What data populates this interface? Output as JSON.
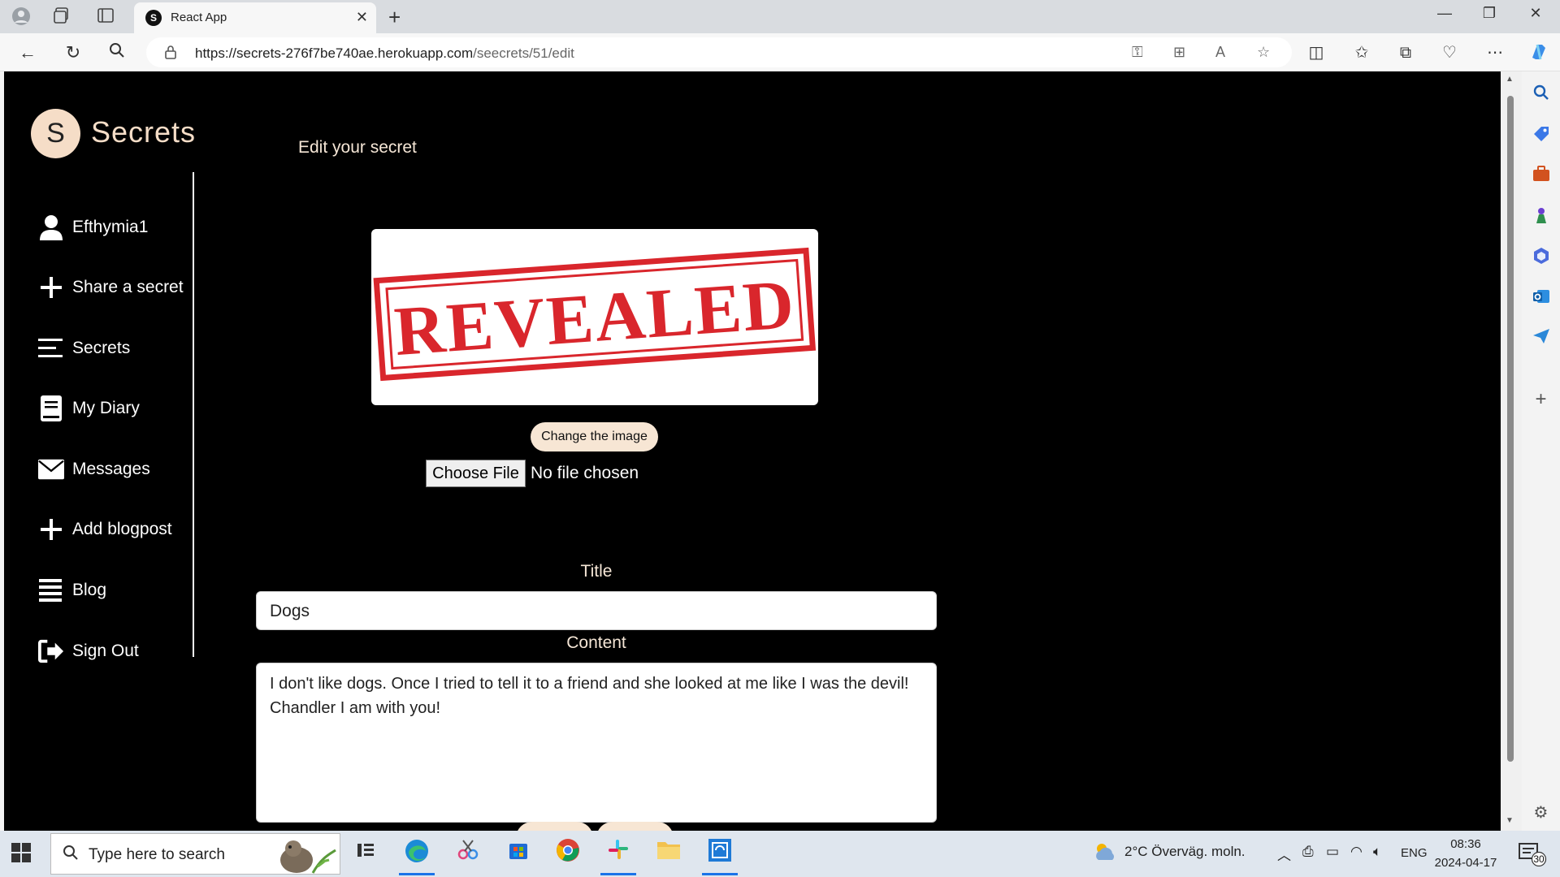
{
  "browser": {
    "tab_title": "React App",
    "tab_favicon_letter": "S",
    "url_host": "https://secrets-276f7be740ae.herokuapp.com",
    "url_path": "/seecrets/51/edit"
  },
  "sidebar": {
    "logo_letter": "S",
    "logo_text": "Secrets",
    "items": [
      {
        "label": "Efthymia1",
        "icon": "user-icon"
      },
      {
        "label": "Share a secret",
        "icon": "plus-icon"
      },
      {
        "label": "Secrets",
        "icon": "list-icon"
      },
      {
        "label": "My Diary",
        "icon": "book-icon"
      },
      {
        "label": "Messages",
        "icon": "envelope-icon"
      },
      {
        "label": "Add blogpost",
        "icon": "plus-icon"
      },
      {
        "label": "Blog",
        "icon": "list-icon"
      },
      {
        "label": "Sign Out",
        "icon": "sign-out-icon"
      }
    ]
  },
  "form": {
    "heading": "Edit your secret",
    "image_text": "REVEALED",
    "change_image_label": "Change the image",
    "file_button_label": "Choose File",
    "file_status": "No file chosen",
    "title_label": "Title",
    "title_value": "Dogs",
    "content_label": "Content",
    "content_value": "I don't like dogs. Once I tried to tell it to a friend and she looked at me like I was the devil! Chandler I am with you!"
  },
  "taskbar": {
    "search_placeholder": "Type here to search",
    "weather": "2°C  Överväg. moln.",
    "language": "ENG",
    "time": "08:36",
    "date": "2024-04-17",
    "notification_count": "30"
  },
  "colors": {
    "page_bg": "#000000",
    "accent": "#f5ddc7",
    "stamp_red": "#d9262c"
  }
}
